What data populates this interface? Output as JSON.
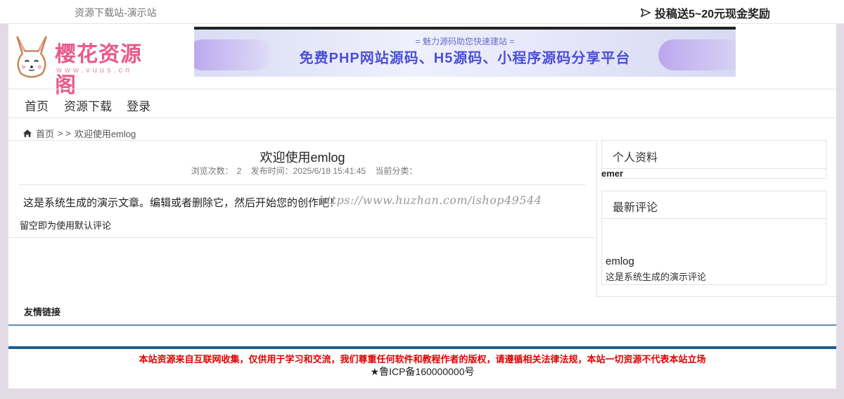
{
  "topbar": {
    "site_title": "资源下载站-演示站",
    "promo": "投稿送5~20元现金奖励",
    "promo_icon": "paper-plane-icon"
  },
  "header": {
    "logo_text": "樱花资源阁",
    "logo_url": "www.vuus.cn",
    "banner_sub": "= 魅力源码助您快速建站 =",
    "banner_main": "免费PHP网站源码、H5源码、小程序源码分享平台"
  },
  "nav": [
    "首页",
    "资源下载",
    "登录"
  ],
  "breadcrumb": {
    "home": "首页",
    "sep": "> >",
    "current": "欢迎使用emlog",
    "icon": "home-icon"
  },
  "post": {
    "title": "欢迎使用emlog",
    "views_label": "浏览次数：",
    "views": "2",
    "date_label": "发布时间：",
    "date": "2025/6/18 15:41:45",
    "category_label": "当前分类：",
    "body": "这是系统生成的演示文章。编辑或者删除它，然后开始您的创作吧！",
    "comment_hint": "留空即为使用默认评论"
  },
  "watermark": "https://www.huzhan.com/ishop49544",
  "sidebar": {
    "profile_title": "个人资料",
    "author": "emer",
    "comments_title": "最新评论",
    "comment_name": "emlog",
    "comment_text": "这是系统生成的演示评论"
  },
  "footer": {
    "links_title": "友情链接",
    "notice": "本站资源来自互联网收集，仅供用于学习和交流，我们尊重任何软件和教程作者的版权，请遵循相关法律法规，本站一切资源不代表本站立场",
    "icp": "★鲁ICP备160000000号"
  },
  "colors": {
    "accent": "#1d5e94",
    "notice": "#e00000",
    "logo": "#e85a8a"
  }
}
